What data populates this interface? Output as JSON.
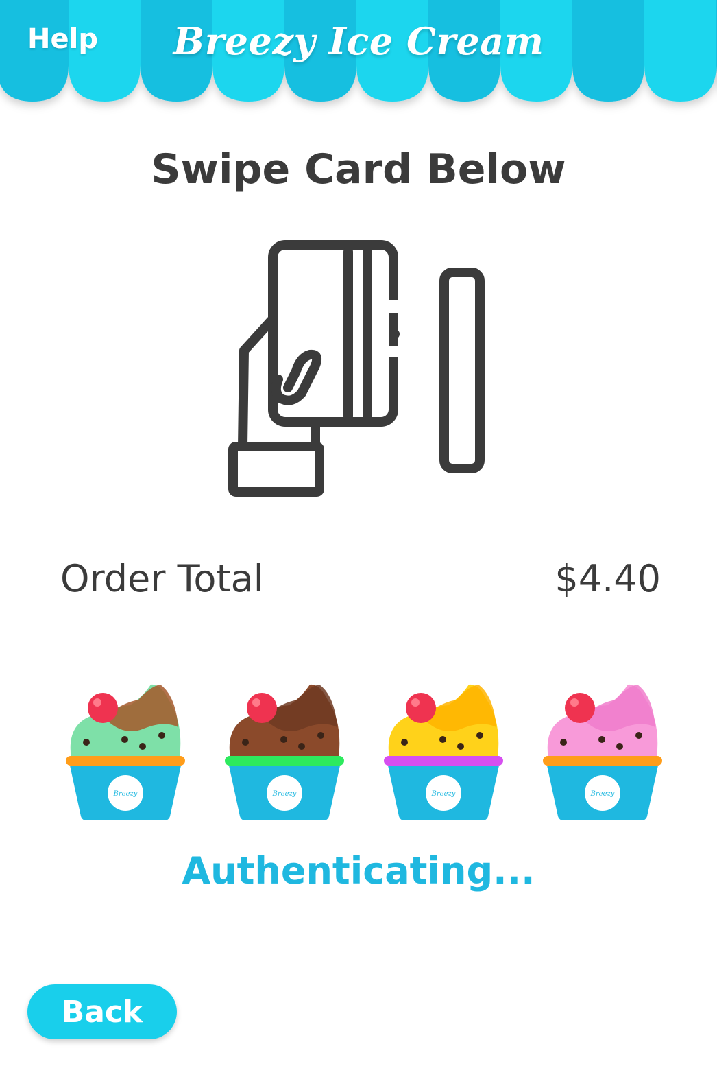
{
  "header": {
    "help_label": "Help",
    "app_title": "Breezy Ice Cream"
  },
  "payment": {
    "instruction": "Swipe Card Below",
    "order_total_label": "Order Total",
    "order_total_value": "$4.40",
    "status": "Authenticating..."
  },
  "cups": [
    {
      "flavor_color": "#7ee0a8",
      "top_color": "#a4582a",
      "band_color": "#ff9d1a",
      "logo_text": "Breezy"
    },
    {
      "flavor_color": "#8b4a2b",
      "top_color": "#6e3a22",
      "band_color": "#2dea5e",
      "logo_text": "Breezy"
    },
    {
      "flavor_color": "#ffd21a",
      "top_color": "#ffb400",
      "band_color": "#d64ff0",
      "logo_text": "Breezy"
    },
    {
      "flavor_color": "#f89ad9",
      "top_color": "#f07ccb",
      "band_color": "#ff9d1a",
      "logo_text": "Breezy"
    }
  ],
  "footer": {
    "back_label": "Back"
  },
  "colors": {
    "awning_light": "#1fd6ee",
    "awning_dark": "#13bfe0",
    "accent": "#19cfeb",
    "text_dark": "#3b3b3b"
  },
  "icons": {
    "card_swipe": "hand-holding-card-icon",
    "card_reader": "card-reader-slot-icon"
  }
}
